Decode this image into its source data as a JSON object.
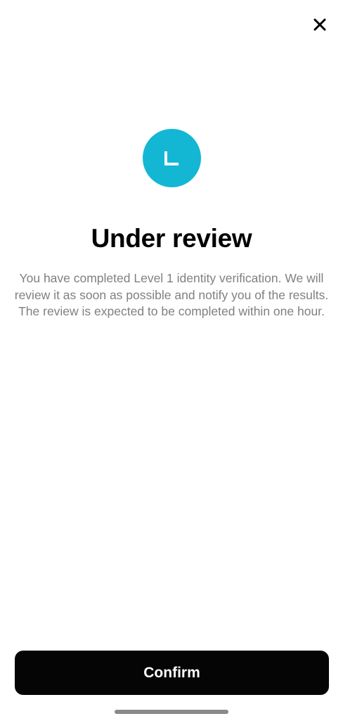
{
  "header": {
    "close_icon": "close-icon"
  },
  "status": {
    "icon": "clock-icon",
    "color": "#13B7D4"
  },
  "main": {
    "title": "Under review",
    "description": "You have completed Level 1 identity verification. We will review it as soon as possible and notify you of the results. The review is expected to be completed within one hour."
  },
  "footer": {
    "confirm_label": "Confirm",
    "button_color": "#050505"
  }
}
